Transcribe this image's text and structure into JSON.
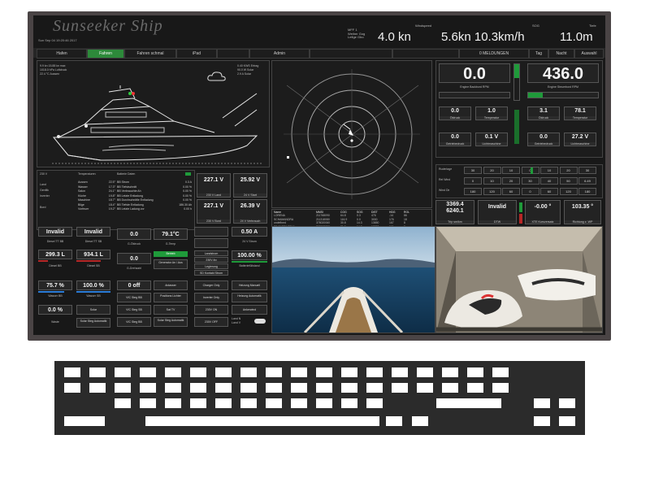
{
  "header": {
    "brand": "Sunseeker Ship",
    "datetime": "Sun Sep 04 19:20:46 2017",
    "mode_lines": [
      "MFF 1",
      "Weiher Gog",
      "Lefige Gbo"
    ],
    "windspeed_label": "Windspeed",
    "windspeed_value": "4.0 kn",
    "sog_label": "SOG",
    "sog_value": "5.6kn 10.3km/h",
    "tiefe_label": "Tiefe",
    "tiefe_value": "11.0m"
  },
  "nav": {
    "hafen": "Hafen",
    "fahren": "Fahren",
    "fahren_schmal": "Fahren schmal",
    "ipad": "iPad",
    "admin": "Admin",
    "meldungen": "0 MELDUNGEN",
    "tag": "Tag",
    "nacht": "Nacht",
    "auswahl": "Auswahl"
  },
  "yacht": {
    "left_info": [
      "9.9 kn  15.88 kn max",
      "1018.0 hPa Luftdruck",
      "22.4 °C Aussen"
    ],
    "right_info": [
      "0.40 KWS Ertrag",
      "90.0 W Solar",
      "2.9 A Solar"
    ]
  },
  "engines": {
    "backbord_rpm": "0.0",
    "backbord_label": "Engine Backbord RPM",
    "steuerbord_rpm": "436.0",
    "steuerbord_label": "Engine Steuerbord RPM",
    "bb_oeldruck": "0.0",
    "bb_temperatur": "1.0",
    "sb_oeldruck": "3.1",
    "sb_temperatur": "78.1",
    "oeldruck_label": "Öldruck",
    "temperatur_label": "Temperatur",
    "bb_getriebedruck": "0.0",
    "bb_lichtmaschine": "0.1 V",
    "sb_getriebedruck": "0.0",
    "sb_lichtmaschine": "27.2 V",
    "getriebedruck_label": "Getriebedruck",
    "lichtmaschine_label": "Lichtmaschine"
  },
  "rudder": {
    "label": "Ruderlage",
    "ticks": [
      "30",
      "20",
      "10",
      "0",
      "10",
      "20",
      "30"
    ],
    "rel_wind_label": "Rel Wind",
    "rel_wind_ticks": [
      "0",
      "10",
      "20",
      "30",
      "40",
      "50",
      "6.49"
    ],
    "wind_dir_label": "Wind Dir",
    "wind_dir_ticks": [
      "180",
      "120",
      "60",
      "0",
      "60",
      "120",
      "180"
    ]
  },
  "trip": {
    "trip_value": "3369.4",
    "trip_value2": "6240.1",
    "trip_label": "Trip sm/km",
    "dtw_value": "Invalid",
    "dtw_label": "DTW",
    "xte_value": "-0.00 °",
    "xte_label": "XTE Kursversatz",
    "wp_value": "103.35 °",
    "wp_label": "Richtung z. WP"
  },
  "power": {
    "panel_header": "230 V",
    "temp_header": "Temperaturen",
    "battery_header": "Batterie Daten",
    "temps": [
      [
        "Aussen",
        "22.5°"
      ],
      [
        "Wasser",
        "17.3°"
      ],
      [
        "Salon",
        "24.1°"
      ],
      [
        "Küche",
        "19.8°"
      ],
      [
        "Maschine",
        "18.7°"
      ],
      [
        "Bilge",
        "18.4°"
      ],
      [
        "Vorfeuer",
        "19.2°"
      ]
    ],
    "battery_rows": [
      [
        "BB Strom",
        "0.3 A"
      ],
      [
        "BB Tiefstschnitt",
        "0.00 %"
      ],
      [
        "BB Verbrauchte Ah",
        "0.00 %"
      ],
      [
        "BB Letzte Entladung",
        "0.00 %"
      ],
      [
        "BB Durchschnittle Entladung",
        "0.00 %"
      ],
      [
        "BB Tiefste Entladung",
        "186.30 Ah"
      ],
      [
        "BB Letzte Ladung vor",
        "0.00 h"
      ]
    ],
    "shore_rows": [
      "Land",
      "Genflik",
      "Inverter",
      "Bord"
    ],
    "v_land": "227.1 V",
    "v_start": "25.92 V",
    "v_land_label": "230 V Land",
    "v_start_label": "24 V Start",
    "v_bord": "227.1 V",
    "v_verbrauch": "26.39 V",
    "v_bord_label": "230 V Bord",
    "v_verbrauch_label": "24 V Verbrauch"
  },
  "nmea_table": {
    "headers": [
      "Name",
      "MMSI",
      "COG",
      "SOG",
      "DIST",
      "HDG",
      "ROL"
    ],
    "rows": [
      [
        "LORENA",
        "211768090",
        "64.8",
        "0.3",
        "476",
        "-14",
        "86"
      ],
      [
        "SCHAMANDRA",
        "211318080",
        "116.9",
        "0.0",
        "3000",
        "176",
        "18"
      ],
      [
        "undefined",
        "378020060",
        "30.8",
        "14.3",
        "13650",
        "167",
        "8"
      ],
      [
        "BF CARTAGENA",
        "308007090",
        "31.0",
        "14.3",
        "13220",
        "161",
        "9"
      ]
    ]
  },
  "tanks": {
    "diesel_bb_top": "Invalid",
    "diesel_sb_top": "Invalid",
    "diesel_tt_bb": "Diesel TT BB",
    "diesel_tt_sb": "Diesel TT SB",
    "diesel_bb_val": "299.3 L",
    "diesel_sb_val": "934.1 L",
    "diesel_bb": "Diesel BB",
    "diesel_sb": "Diesel SB",
    "wasser_bb_val": "75.7 %",
    "wasser_sb_val": "100.0 %",
    "wasser_bb": "Wasser BB",
    "wasser_sb": "Wasser SB",
    "waste_val": "0.0 %",
    "waste": "Waste",
    "solar_btn": "Solar",
    "solar_steg_btn": "Solar Steg Automatik"
  },
  "generator": {
    "oeldruck_val": "0.0",
    "temp_val": "79.1°C",
    "oeldruck_label": "G-Öldruck",
    "temp_label": "G-Temp",
    "drehzahl_val": "0.0",
    "drehzahl_label": "G-Drehzahl",
    "status_label": "Betrieb",
    "gen_btn": "Generator An / Aus",
    "off_val": "0 off",
    "anlasser": "Anlasser",
    "vic_steg_bb": "VIC Steg BB",
    "vic_steg_sb": "VIC Steg SB",
    "vic_steg_bb2": "VIC Steg BB",
    "positions_lichter": "Positions Lichter",
    "sat_tv": "Sat TV",
    "solar_steg": "Solar Steg Automatik"
  },
  "chargers": {
    "amp_val": "0.50 A",
    "amp_label": "24 V Strom",
    "pct_val": "100.00 %",
    "pct_label": "Batteriefüllstand",
    "landstrom": "Landstrom",
    "v230_an": "230V An",
    "legierung": "Legierung",
    "ssd_kontakt": "SD Kontakt Strom",
    "charger_only": "Charger Only",
    "heizung_manuell": "Heizung Manuell",
    "inverter_only": "Inverter Only",
    "heizung_auto": "Heizung Automatik",
    "v230_on": "230V ON",
    "ankerwind": "Ankerwind",
    "v230_off": "230V OFF",
    "land_n": "Land N",
    "land_v": "Land V"
  },
  "colors": {
    "accent": "#1f9a3a",
    "danger": "#b72727",
    "level": "#2a7bd6",
    "bezel": "#4a4445"
  }
}
